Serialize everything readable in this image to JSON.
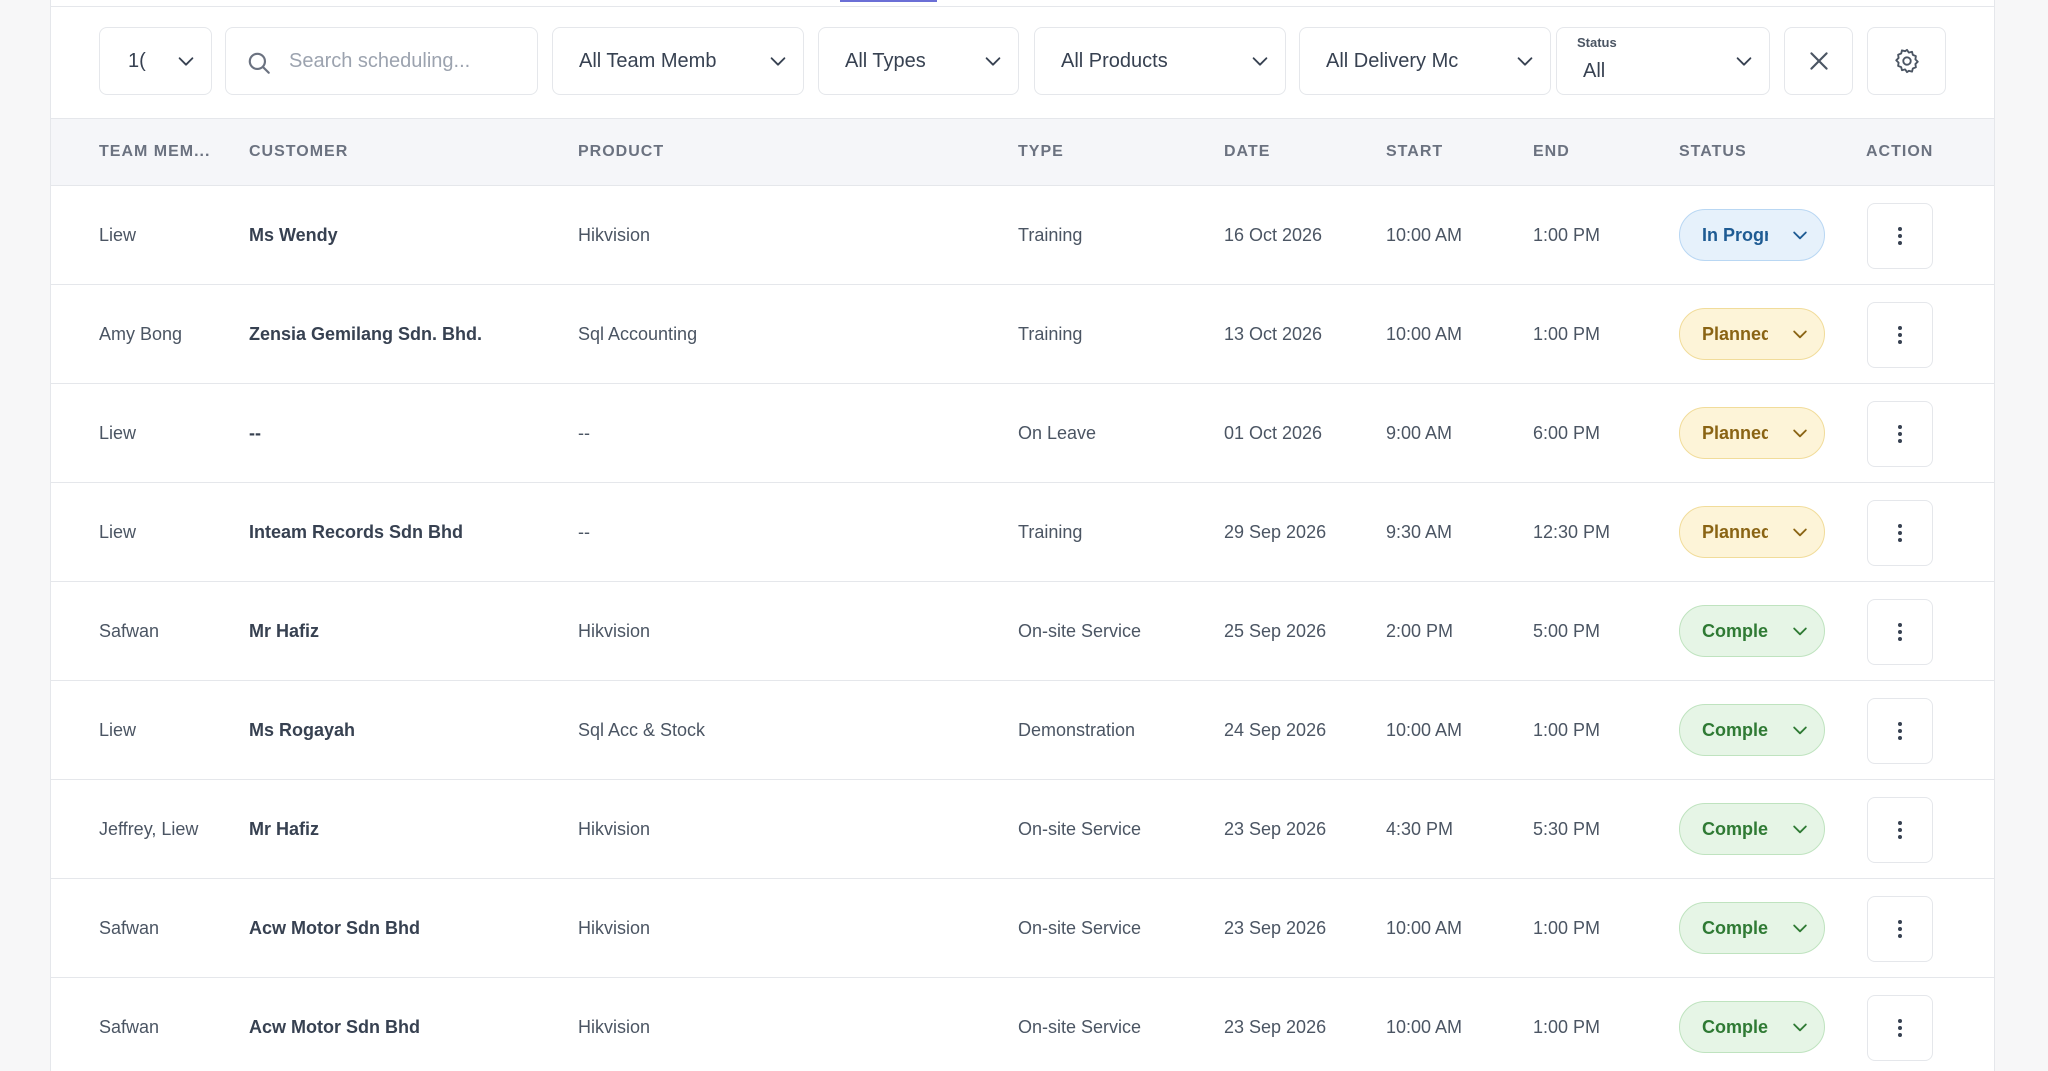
{
  "filters": {
    "page_size_value": "1(",
    "search_placeholder": "Search scheduling...",
    "team_member": "All Team Memb",
    "type": "All Types",
    "product": "All Products",
    "delivery_mode": "All Delivery Mc",
    "status_label": "Status",
    "status_value": "All"
  },
  "columns": {
    "team_member": "TEAM MEM...",
    "customer": "CUSTOMER",
    "product": "PRODUCT",
    "type": "TYPE",
    "date": "DATE",
    "start": "START",
    "end": "END",
    "status": "STATUS",
    "action": "ACTION"
  },
  "rows": [
    {
      "team_member": "Liew",
      "customer": "Ms Wendy",
      "product": "Hikvision",
      "type": "Training",
      "date": "16 Oct 2026",
      "start": "10:00 AM",
      "end": "1:00 PM",
      "status": "In Progress",
      "status_kind": "progress"
    },
    {
      "team_member": "Amy Bong",
      "customer": "Zensia Gemilang Sdn. Bhd.",
      "product": "Sql Accounting",
      "type": "Training",
      "date": "13 Oct 2026",
      "start": "10:00 AM",
      "end": "1:00 PM",
      "status": "Planned",
      "status_kind": "planned"
    },
    {
      "team_member": "Liew",
      "customer": "--",
      "product": "--",
      "type": "On Leave",
      "date": "01 Oct 2026",
      "start": "9:00 AM",
      "end": "6:00 PM",
      "status": "Planned",
      "status_kind": "planned"
    },
    {
      "team_member": "Liew",
      "customer": "Inteam Records Sdn Bhd",
      "product": "--",
      "type": "Training",
      "date": "29 Sep 2026",
      "start": "9:30 AM",
      "end": "12:30 PM",
      "status": "Planned",
      "status_kind": "planned"
    },
    {
      "team_member": "Safwan",
      "customer": "Mr Hafiz",
      "product": "Hikvision",
      "type": "On-site Service",
      "date": "25 Sep 2026",
      "start": "2:00 PM",
      "end": "5:00 PM",
      "status": "Completed",
      "status_kind": "completed"
    },
    {
      "team_member": "Liew",
      "customer": "Ms Rogayah",
      "product": "Sql Acc & Stock",
      "type": "Demonstration",
      "date": "24 Sep 2026",
      "start": "10:00 AM",
      "end": "1:00 PM",
      "status": "Completed",
      "status_kind": "completed"
    },
    {
      "team_member": "Jeffrey, Liew",
      "customer": "Mr Hafiz",
      "product": "Hikvision",
      "type": "On-site Service",
      "date": "23 Sep 2026",
      "start": "4:30 PM",
      "end": "5:30 PM",
      "status": "Completed",
      "status_kind": "completed"
    },
    {
      "team_member": "Safwan",
      "customer": "Acw Motor Sdn Bhd",
      "product": "Hikvision",
      "type": "On-site Service",
      "date": "23 Sep 2026",
      "start": "10:00 AM",
      "end": "1:00 PM",
      "status": "Completed",
      "status_kind": "completed"
    },
    {
      "team_member": "Safwan",
      "customer": "Acw Motor Sdn Bhd",
      "product": "Hikvision",
      "type": "On-site Service",
      "date": "23 Sep 2026",
      "start": "10:00 AM",
      "end": "1:00 PM",
      "status": "Completed",
      "status_kind": "completed"
    }
  ],
  "icons": {
    "search": "search-icon",
    "chevron": "chevron-down-icon",
    "clear": "close-icon",
    "settings": "gear-icon",
    "row_menu": "more-vertical-icon"
  },
  "colors": {
    "accent": "#6b6fd6",
    "status_progress_bg": "#e6f1fb",
    "status_progress_text": "#1e5b93",
    "status_planned_bg": "#fdf4d8",
    "status_planned_text": "#8a6414",
    "status_completed_bg": "#e6f5e6",
    "status_completed_text": "#2f7a34"
  }
}
